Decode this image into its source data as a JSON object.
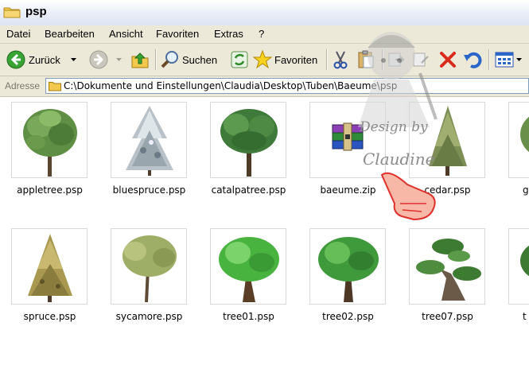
{
  "window": {
    "title": "psp"
  },
  "menu": [
    "Datei",
    "Bearbeiten",
    "Ansicht",
    "Favoriten",
    "Extras",
    "?"
  ],
  "toolbar": {
    "back_label": "Zurück",
    "search_label": "Suchen",
    "favorites_label": "Favoriten"
  },
  "address": {
    "label": "Adresse",
    "path": "C:\\Dokumente und Einstellungen\\Claudia\\Desktop\\Tuben\\Baeume\\psp"
  },
  "watermark": {
    "line1": "Design by",
    "line2": "Claudine"
  },
  "files": [
    {
      "name": "appletree.psp",
      "icon": "apple-tree-icon"
    },
    {
      "name": "bluespruce.psp",
      "icon": "blue-spruce-icon"
    },
    {
      "name": "catalpatree.psp",
      "icon": "catalpa-tree-icon"
    },
    {
      "name": "baeume.zip",
      "icon": "zip-archive-icon"
    },
    {
      "name": "cedar.psp",
      "icon": "cedar-tree-icon"
    },
    {
      "name": "go",
      "icon": "tree-icon"
    },
    {
      "name": "spruce.psp",
      "icon": "spruce-tree-icon"
    },
    {
      "name": "sycamore.psp",
      "icon": "sycamore-tree-icon"
    },
    {
      "name": "tree01.psp",
      "icon": "tree-icon"
    },
    {
      "name": "tree02.psp",
      "icon": "tree-icon"
    },
    {
      "name": "tree07.psp",
      "icon": "bonsai-tree-icon"
    },
    {
      "name": "t",
      "icon": "tree-icon"
    }
  ],
  "colors": {
    "chrome": "#ece9d8",
    "address_border": "#7f9db9",
    "back_green": "#3aa335",
    "close_red": "#d92b1c",
    "undo_blue": "#2a66c8"
  }
}
